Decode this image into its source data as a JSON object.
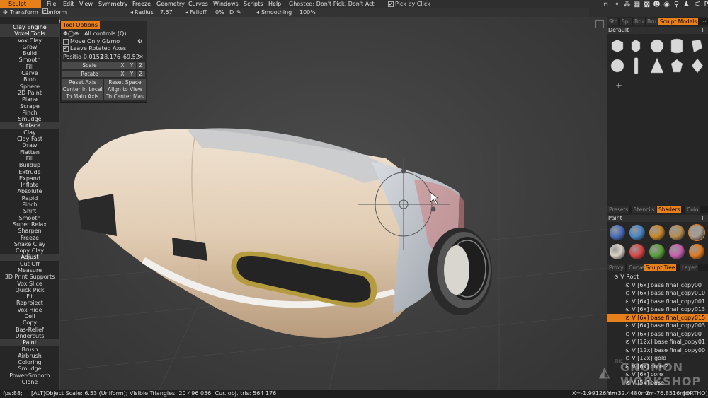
{
  "menubar": {
    "mode": "Sculpt",
    "menus": [
      "File",
      "Edit",
      "View",
      "Symmetry",
      "Freeze",
      "Geometry",
      "Curves",
      "Windows",
      "Scripts",
      "Help"
    ],
    "ghosted": "Ghosted: Don't Pick, Don't Act",
    "pick_by_click": "Pick by Click"
  },
  "toolbar2": {
    "transform": "Transform",
    "conform": "Conform Retopo Mesh",
    "radius_label": "Radius",
    "radius_value": "7.57",
    "falloff_label": "Falloff",
    "falloff_value": "0%",
    "d_label": "D",
    "smoothing_label": "Smoothing",
    "smoothing_value": "100%"
  },
  "left_panel": {
    "items": [
      {
        "label": "Clay Engine",
        "header": true
      },
      {
        "label": "Voxel Tools",
        "header": true
      },
      {
        "label": "Vox Clay"
      },
      {
        "label": "Grow"
      },
      {
        "label": "Build"
      },
      {
        "label": "Smooth"
      },
      {
        "label": "Fill"
      },
      {
        "label": "Carve"
      },
      {
        "label": "Blob"
      },
      {
        "label": "Sphere"
      },
      {
        "label": "2D-Paint"
      },
      {
        "label": "Plane"
      },
      {
        "label": "Scrape"
      },
      {
        "label": "Pinch"
      },
      {
        "label": "Smudge"
      },
      {
        "label": "Surface",
        "header": true
      },
      {
        "label": "Clay"
      },
      {
        "label": "Clay Fast"
      },
      {
        "label": "Draw"
      },
      {
        "label": "Flatten"
      },
      {
        "label": "Fill"
      },
      {
        "label": "Buildup"
      },
      {
        "label": "Extrude"
      },
      {
        "label": "Expand"
      },
      {
        "label": "Inflate"
      },
      {
        "label": "Absolute"
      },
      {
        "label": "Rapid"
      },
      {
        "label": "Pinch"
      },
      {
        "label": "Shift"
      },
      {
        "label": "Smooth"
      },
      {
        "label": "Super Relax"
      },
      {
        "label": "Sharpen"
      },
      {
        "label": "Freeze"
      },
      {
        "label": "Snake Clay"
      },
      {
        "label": "Copy Clay"
      },
      {
        "label": "Adjust",
        "header": true
      },
      {
        "label": "Cut Off"
      },
      {
        "label": "Measure"
      },
      {
        "label": "3D Print Supports"
      },
      {
        "label": "Vox Slice"
      },
      {
        "label": "Quick Pick"
      },
      {
        "label": "Fit"
      },
      {
        "label": "Reproject"
      },
      {
        "label": "Vox Hide"
      },
      {
        "label": "Cell"
      },
      {
        "label": "Copy"
      },
      {
        "label": "Bas-Relief"
      },
      {
        "label": "Undercuts"
      },
      {
        "label": "Paint",
        "header": true
      },
      {
        "label": "Brush"
      },
      {
        "label": "Airbrush"
      },
      {
        "label": "Coloring"
      },
      {
        "label": "Smudge"
      },
      {
        "label": "Power-Smooth"
      },
      {
        "label": "Clone"
      }
    ]
  },
  "tool_options": {
    "title": "Tool Options",
    "all_controls": "All controls (Q)",
    "move_only_gizmo": "Move Only Gizmo",
    "leave_rotated_axes": "Leave Rotated Axes",
    "position_label": "Positio",
    "pos_x": "-0.0153",
    "pos_y": "28.176",
    "pos_z": "-69.52",
    "scale": "Scale",
    "rotate": "Rotate",
    "x": "X",
    "y": "Y",
    "z": "Z",
    "reset_axis": "Reset Axis",
    "reset_space": "Reset Space",
    "center_in_local": "Center in Local",
    "align_to_view": "Align to View",
    "to_main_axis": "To Main Axis",
    "to_center_mass": "To Center Mas"
  },
  "right_panel": {
    "tabs_top": [
      {
        "label": "Str",
        "active": false
      },
      {
        "label": "Spl",
        "active": false
      },
      {
        "label": "Bru",
        "active": false
      },
      {
        "label": "Bru",
        "active": false
      },
      {
        "label": "Sculpt Models",
        "active": true
      }
    ],
    "default_label": "Default",
    "plus": "+",
    "tabs_mid": [
      {
        "label": "Presets",
        "active": false
      },
      {
        "label": "Stencils",
        "active": false
      },
      {
        "label": "Shaders",
        "active": true
      },
      {
        "label": "Colo",
        "active": false
      }
    ],
    "paint_label": "Paint",
    "shader_colors": [
      "#4a6fb8",
      "#4a86c4",
      "#c9882a",
      "#b78d52",
      "#a89c90",
      "#d8d0c4",
      "#d94848",
      "#5aa03c",
      "#c860b0",
      "#e07a22"
    ],
    "tabs_bottom": [
      {
        "label": "Proxy",
        "active": false
      },
      {
        "label": "Curve",
        "active": false
      },
      {
        "label": "Sculpt Tree",
        "active": true
      },
      {
        "label": "Layer",
        "active": false
      }
    ],
    "tree": [
      {
        "text": "V  Root",
        "selected": false
      },
      {
        "text": "V  [6x]  base  final_copy00",
        "selected": false
      },
      {
        "text": "V  [6x]  base  final_copy010",
        "selected": false
      },
      {
        "text": "V  [6x]  base  final_copy001",
        "selected": false
      },
      {
        "text": "V  [6x]  base  final_copy013",
        "selected": false
      },
      {
        "text": "V  [6x]  base  final_copy015",
        "selected": true
      },
      {
        "text": "V  [6x]  base  final_copy003",
        "selected": false
      },
      {
        "text": "V  [6x]  base  final_copy00",
        "selected": false
      },
      {
        "text": "V  [12x]  base  final_copy01",
        "selected": false
      },
      {
        "text": "V  [12x]  base  final_copy00",
        "selected": false
      },
      {
        "text": "V  [12x]  gold",
        "selected": false
      },
      {
        "text": "V  [6x]  core 2",
        "selected": false
      },
      {
        "text": "V  [6x]  core",
        "selected": false
      },
      {
        "text": "V  [5x]  base",
        "selected": false
      }
    ]
  },
  "watermark": {
    "line1": "THE",
    "line2": "GNOMON",
    "line3": "WORKSHOP"
  },
  "statusbar": {
    "fps": "fps:88;",
    "info": "[ALT]Object Scale: 6.53 (Uniform); Visible Triangles: 20 496 056; Cur. obj. tris: 564 176",
    "x": "X=-1.99126mm",
    "y": "Y=-32.4480mm",
    "z": "Z=-76.8516mm",
    "ortho": "[ORTHO]"
  },
  "colors": {
    "accent": "#e8801a",
    "body": "#e6d3be",
    "dark_panel": "#2a2a2a",
    "gold": "#b59b3f"
  }
}
